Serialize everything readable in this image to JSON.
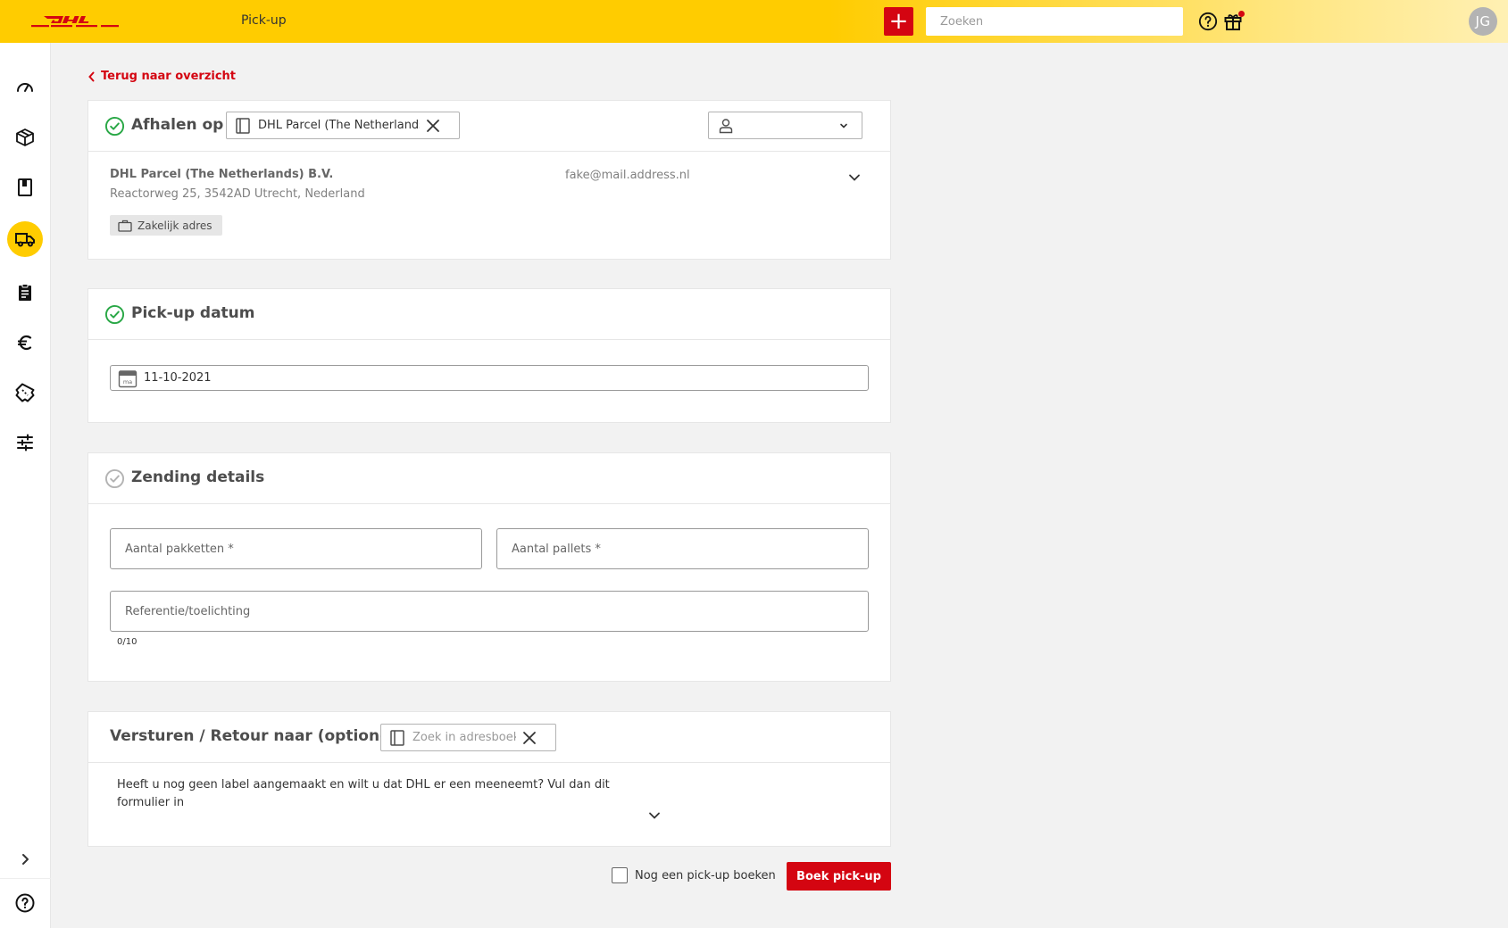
{
  "header": {
    "page_label": "Pick-up",
    "add_icon": "plus-icon",
    "search_placeholder": "Zoeken",
    "avatar_initials": "JG"
  },
  "sidebar": {
    "items": [
      {
        "icon": "speedometer-icon"
      },
      {
        "icon": "package-icon"
      },
      {
        "icon": "book-icon"
      },
      {
        "icon": "truck-icon",
        "active": true
      },
      {
        "icon": "clipboard-icon"
      },
      {
        "icon": "euro-icon"
      },
      {
        "icon": "ticket-icon"
      },
      {
        "icon": "sliders-icon"
      }
    ],
    "expand_icon": "chevron-right-icon",
    "help_icon": "help-icon"
  },
  "back_link": "Terug naar overzicht",
  "pickup_location": {
    "title": "Afhalen op",
    "address_book_value": "DHL Parcel (The Netherlands) B.V.",
    "company": "DHL Parcel (The Netherlands) B.V.",
    "address": "Reactorweg 25, 3542AD Utrecht, Nederland",
    "email": "fake@mail.address.nl",
    "badge": "Zakelijk adres"
  },
  "pickup_date": {
    "title": "Pick-up datum",
    "calendar_label": "ma",
    "value": "11-10-2021"
  },
  "shipment": {
    "title": "Zending details",
    "packages_placeholder": "Aantal pakketten *",
    "pallets_placeholder": "Aantal pallets *",
    "reference_placeholder": "Referentie/toelichting",
    "counter": "0/10"
  },
  "return_to": {
    "title": "Versturen / Retour naar (optioneel)",
    "search_placeholder": "Zoek in adresboek",
    "hint": "Heeft u nog geen label aangemaakt en wilt u dat DHL er een meeneemt? Vul dan dit formulier in"
  },
  "footer": {
    "another_pickup_label": "Nog een pick-up boeken",
    "submit_label": "Boek pick-up"
  },
  "colors": {
    "brand_yellow": "#ffcc00",
    "brand_red": "#d40511",
    "success_green": "#28a745"
  }
}
